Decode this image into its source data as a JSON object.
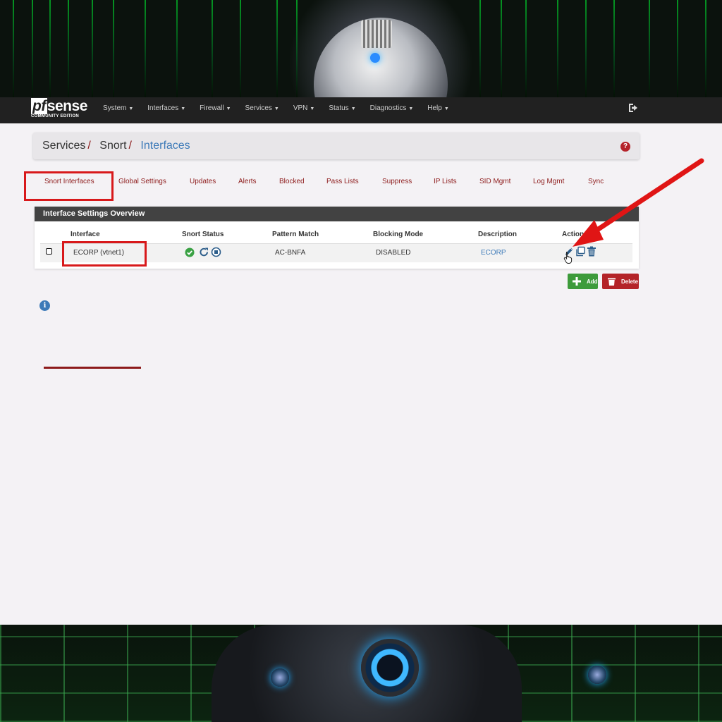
{
  "brand": {
    "logo": "sense",
    "logo_prefix": "pf",
    "edition": "COMMUNITY EDITION"
  },
  "nav": {
    "items": [
      "System",
      "Interfaces",
      "Firewall",
      "Services",
      "VPN",
      "Status",
      "Diagnostics",
      "Help"
    ],
    "logout_icon": "sign-out-icon"
  },
  "breadcrumb": {
    "items": [
      "Services",
      "Snort",
      "Interfaces"
    ],
    "separator": "/",
    "help_icon": "question-circle-icon"
  },
  "tabs": [
    "Snort Interfaces",
    "Global Settings",
    "Updates",
    "Alerts",
    "Blocked",
    "Pass Lists",
    "Suppress",
    "IP Lists",
    "SID Mgmt",
    "Log Mgmt",
    "Sync"
  ],
  "active_tab": "Snort Interfaces",
  "panel": {
    "title": "Interface Settings Overview",
    "columns": [
      "Interface",
      "Snort Status",
      "Pattern Match",
      "Blocking Mode",
      "Description",
      "Actions"
    ],
    "rows": [
      {
        "interface": "ECORP (vtnet1)",
        "status_icons": [
          "check-circle-icon",
          "restart-icon",
          "stop-circle-icon"
        ],
        "pattern_match": "AC-BNFA",
        "blocking_mode": "DISABLED",
        "description": "ECORP",
        "action_icons": [
          "edit-pencil-icon",
          "copy-icon",
          "trash-icon"
        ]
      }
    ]
  },
  "buttons": {
    "add": "Add",
    "delete": "Delete"
  },
  "info_icon": "info-circle-icon",
  "colors": {
    "navbar": "#212121",
    "link_red": "#8d1b1b",
    "link_blue": "#3d7ab8",
    "add_green": "#3d9b3b",
    "delete_red": "#b42328",
    "highlight": "#d8191b"
  }
}
